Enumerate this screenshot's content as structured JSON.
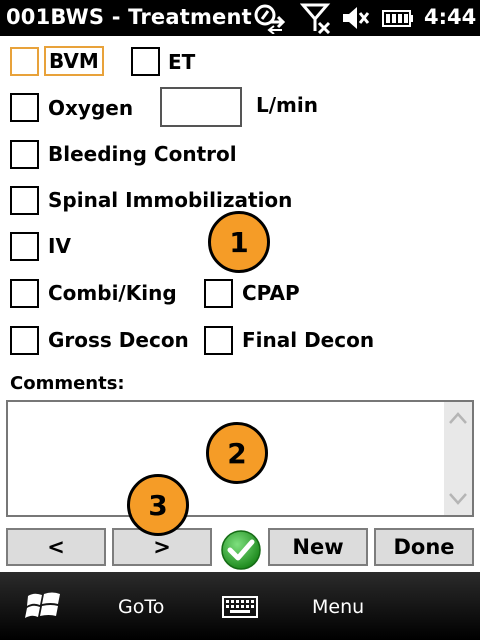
{
  "status": {
    "title": "001BWS - Treatment",
    "time": "4:44",
    "icons": [
      "sync-icon",
      "no-signal-icon",
      "volume-muted-icon",
      "battery-icon"
    ]
  },
  "form": {
    "checkboxes": [
      {
        "label": "BVM",
        "checked": false,
        "focused": true
      },
      {
        "label": "ET",
        "checked": false
      },
      {
        "label": "Oxygen",
        "checked": false
      },
      {
        "label": "Bleeding Control",
        "checked": false
      },
      {
        "label": "Spinal Immobilization",
        "checked": false
      },
      {
        "label": "IV",
        "checked": false
      },
      {
        "label": "Combi/King",
        "checked": false
      },
      {
        "label": "CPAP",
        "checked": false
      },
      {
        "label": "Gross Decon",
        "checked": false
      },
      {
        "label": "Final Decon",
        "checked": false
      }
    ],
    "oxygen_value": "",
    "oxygen_unit": "L/min",
    "comments_label": "Comments:",
    "comments_value": ""
  },
  "buttons": {
    "prev": "<",
    "next": ">",
    "new": "New",
    "done": "Done"
  },
  "badges": [
    "1",
    "2",
    "3"
  ],
  "softkeys": {
    "left": "GoTo",
    "right": "Menu"
  },
  "colors": {
    "focus": "#e8a23a",
    "badge": "#f59c27",
    "ok": "#2ca02c"
  }
}
